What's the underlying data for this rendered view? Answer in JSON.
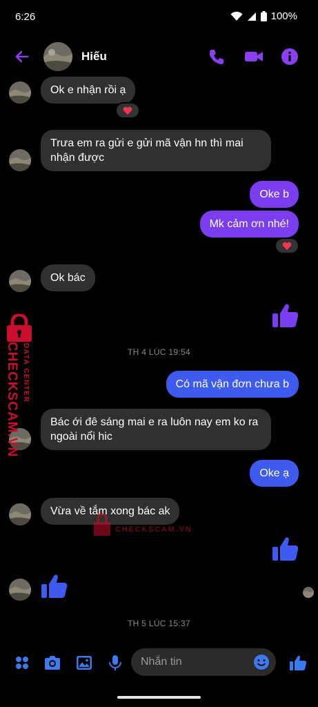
{
  "status": {
    "time": "6:26",
    "battery": "100%",
    "icons": [
      "wifi-icon",
      "signal-icon",
      "battery-icon"
    ]
  },
  "header": {
    "name": "Hiếu",
    "icons": [
      "back-arrow-icon",
      "phone-icon",
      "video-camera-icon",
      "info-icon"
    ]
  },
  "messages": [
    {
      "side": "in",
      "text": "Ok e nhận rồi ạ",
      "reaction": "heart"
    },
    {
      "side": "in",
      "text": "Trưa em ra gửi e gửi mã vận hn thì mai nhận được"
    },
    {
      "side": "out",
      "text": "Oke b"
    },
    {
      "side": "out",
      "text": "Mk cảm ơn nhé!",
      "reaction": "heart"
    },
    {
      "side": "in",
      "text": "Ok bác"
    },
    {
      "side": "out",
      "type": "like"
    },
    {
      "side": "out",
      "text": "Có mã vận đơn chưa b"
    },
    {
      "side": "in",
      "text": "Bác ới đê sáng mai e ra luôn nay em ko ra ngoài nổi hic"
    },
    {
      "side": "out",
      "text": "Oke ạ"
    },
    {
      "side": "in",
      "text": "Vừa về tắm xong bác ak"
    },
    {
      "side": "out",
      "type": "like"
    },
    {
      "side": "in",
      "type": "like"
    }
  ],
  "timestamps": [
    "TH 4 LÚC 19:54",
    "TH 5 LÚC 15:37"
  ],
  "watermark": {
    "brand": "CHECKSCAM.VN",
    "sub": "DATA CENTER"
  },
  "composer": {
    "placeholder": "Nhắn tin",
    "icons": [
      "apps-icon",
      "camera-icon",
      "gallery-icon",
      "microphone-icon",
      "emoji-icon",
      "like-icon"
    ]
  },
  "colors": {
    "accent_purple": "#7b3df0",
    "accent_blue": "#3f5bef",
    "incoming_bubble": "#303030",
    "watermark_red": "#c8102e"
  }
}
